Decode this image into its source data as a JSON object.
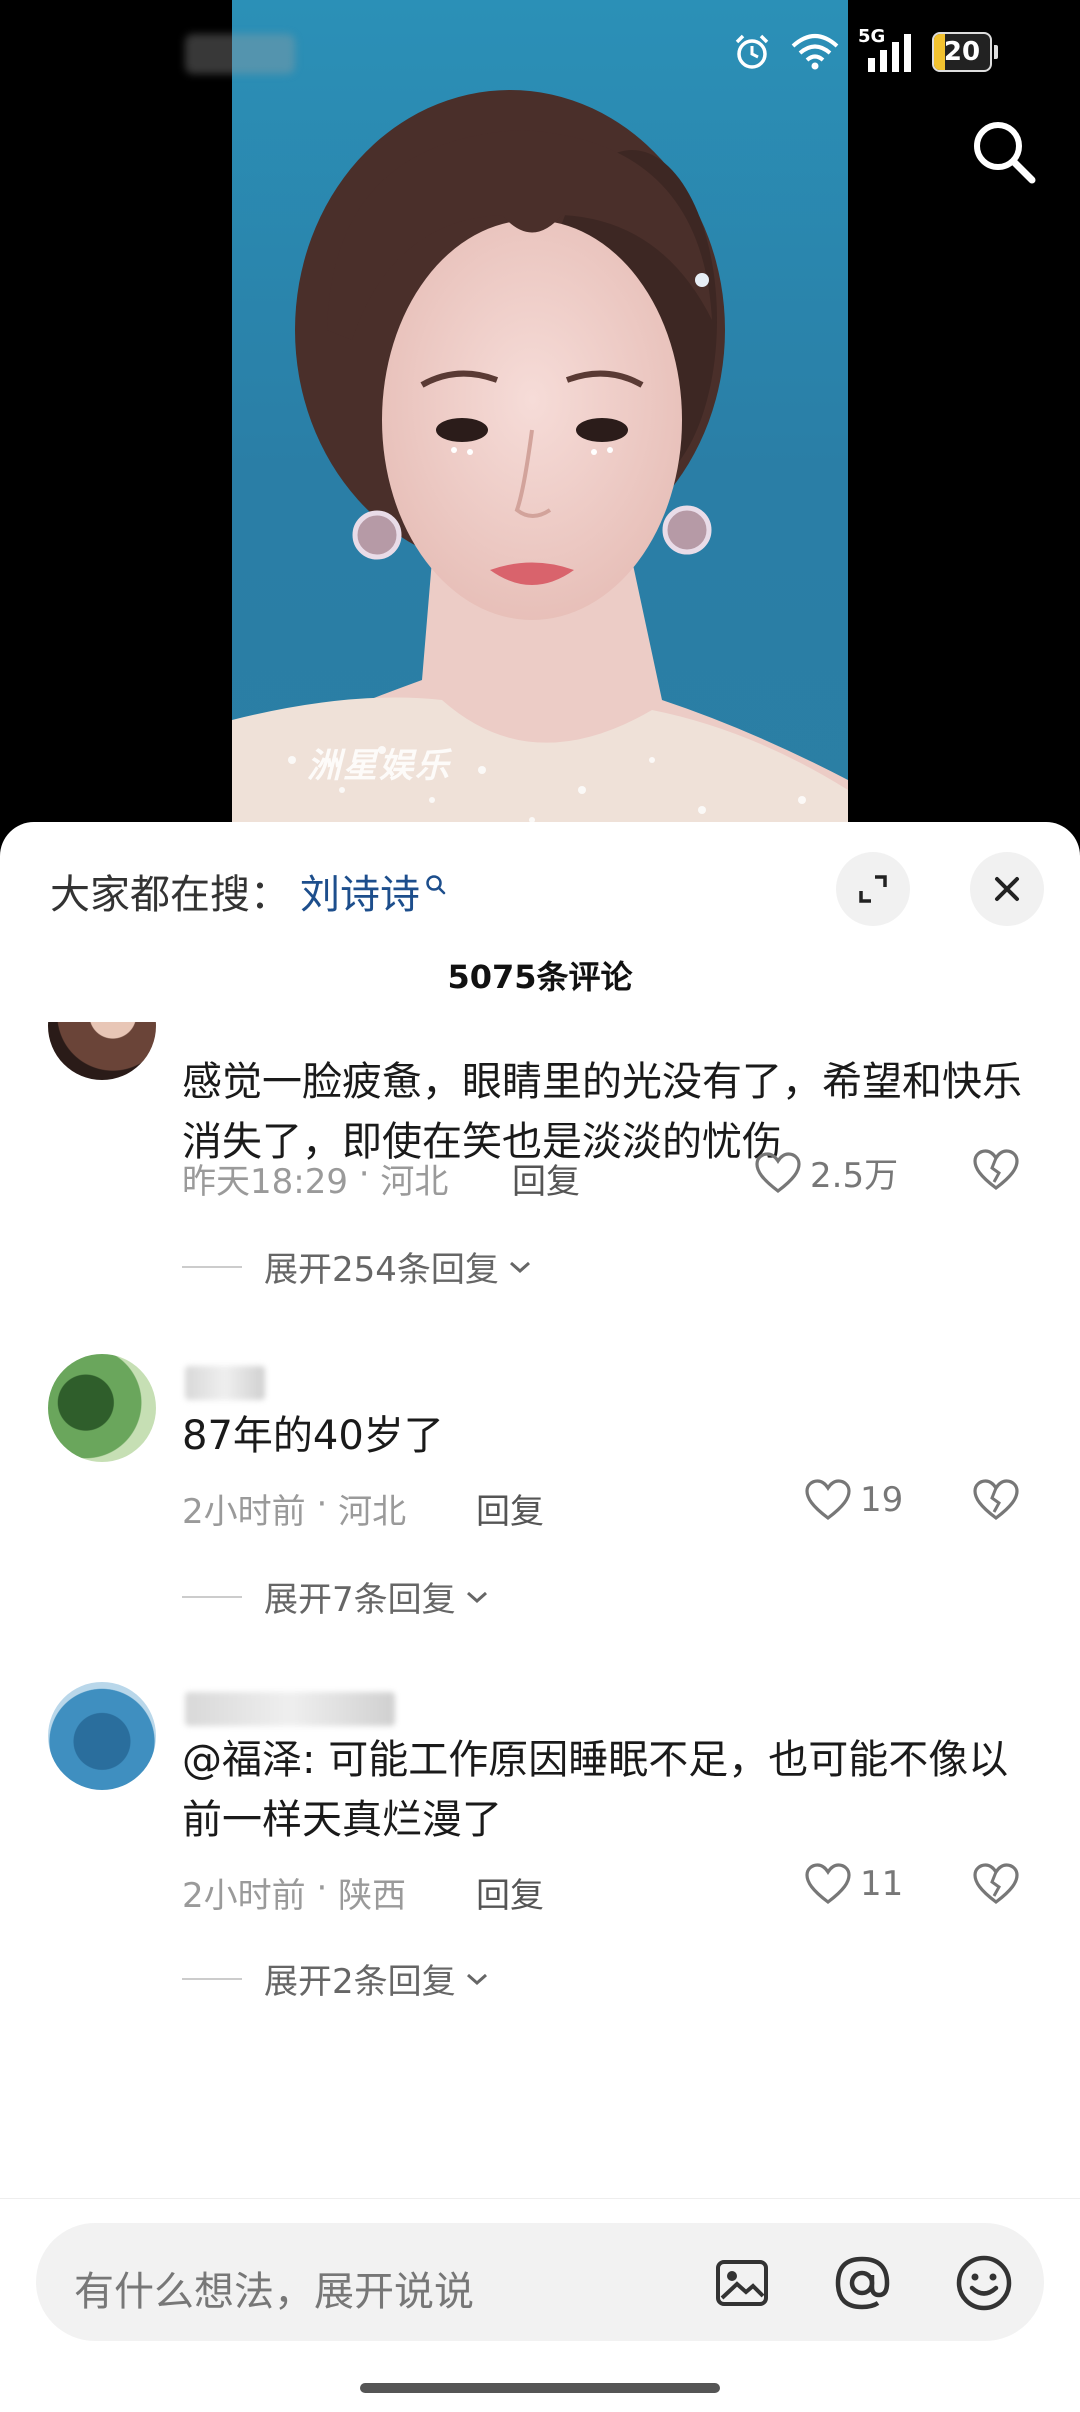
{
  "status_bar": {
    "network": "5G",
    "battery_level": "20",
    "battery_fraction": 0.2,
    "accent": "#f2c230"
  },
  "video": {
    "watermark": "洲星娱乐"
  },
  "panel": {
    "hot_search_label": "大家都在搜：",
    "hot_search_term": "刘诗诗",
    "comment_count": "5075条评论",
    "link_color": "#1d4e8c"
  },
  "comments": [
    {
      "text": "感觉一脸疲惫，眼睛里的光没有了，希望和快乐消失了，即使在笑也是淡淡的忧伤",
      "time": "昨天18:29",
      "location": "河北",
      "reply_label": "回复",
      "likes": "2.5万",
      "expand_label": "展开254条回复"
    },
    {
      "text": "87年的40岁了",
      "time": "2小时前",
      "location": "河北",
      "reply_label": "回复",
      "likes": "19",
      "expand_label": "展开7条回复"
    },
    {
      "text": "@福泽: 可能工作原因睡眠不足，也可能不像以前一样天真烂漫了",
      "time": "2小时前",
      "location": "陕西",
      "reply_label": "回复",
      "likes": "11",
      "expand_label": "展开2条回复"
    }
  ],
  "input_bar": {
    "placeholder": "有什么想法，展开说说",
    "icons": [
      "image-icon",
      "at-icon",
      "emoji-icon"
    ]
  },
  "icons": {
    "search": "search-icon",
    "expand": "expand-icon",
    "close": "close-icon",
    "like": "heart-icon",
    "dislike": "broken-heart-icon"
  }
}
